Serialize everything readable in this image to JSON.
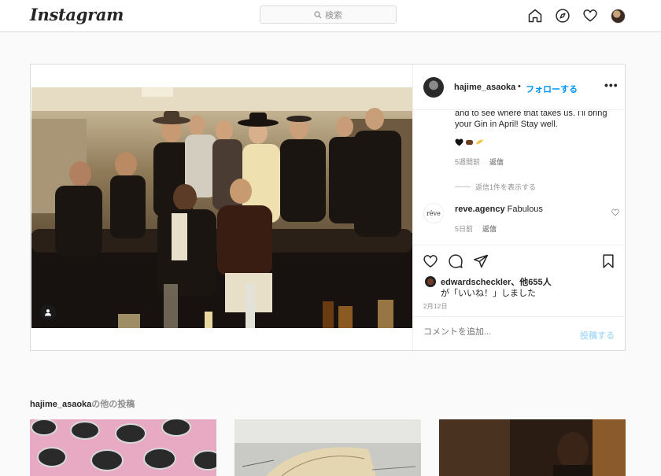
{
  "nav": {
    "logo": "Instagram",
    "search_placeholder": "検索",
    "icons": [
      "home-icon",
      "explore-icon",
      "activity-heart-icon",
      "profile-avatar"
    ]
  },
  "post": {
    "username": "hajime_asaoka",
    "follow_separator": "•",
    "follow_label": "フォローする",
    "more_label": "•••",
    "comments": [
      {
        "text_partial_top": "and to see where that takes us. I'll bring your Gin in April! Stay well.",
        "emojis": [
          "black-heart",
          "brown-fist",
          "yellow-fist"
        ],
        "time": "5週間前",
        "reply": "返信",
        "view_replies": "返信1件を表示する"
      },
      {
        "username": "reve.agency",
        "text": "Fabulous",
        "time": "5日前",
        "reply": "返信",
        "avatar_text": "rêve"
      }
    ],
    "likes": {
      "user": "edwardscheckler",
      "others": "、他655人",
      "suffix": "が「いいね！」しました"
    },
    "date": "2月12日",
    "comment_placeholder": "コメントを追加...",
    "post_button": "投稿する"
  },
  "more": {
    "username": "hajime_asaoka",
    "suffix": "の他の投稿"
  },
  "colors": {
    "accent": "#0095f6",
    "border": "#dbdbdb",
    "muted": "#8e8e8e",
    "text": "#262626"
  }
}
